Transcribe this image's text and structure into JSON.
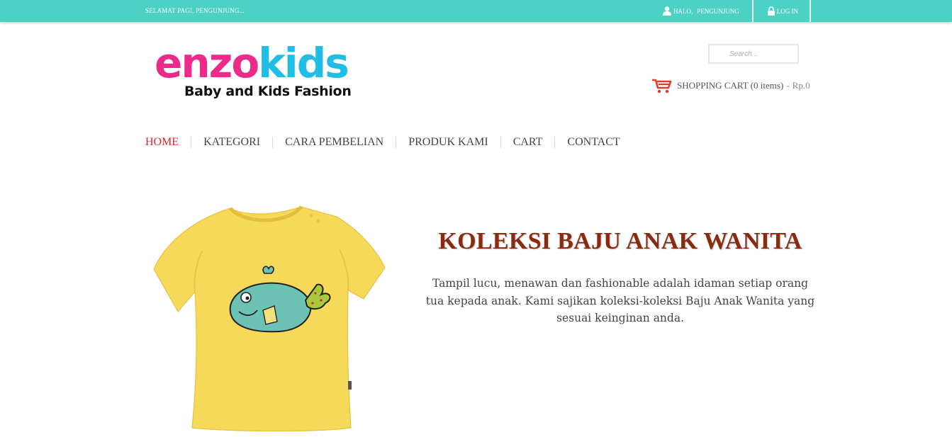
{
  "topbar": {
    "greeting": "SELAMAT PAGI, PENGUNJUNG...",
    "hello_label": "HALO,",
    "hello_user": "PENGUNJUNG",
    "login_label": "LOG IN"
  },
  "logo": {
    "part1": "enzo",
    "part2": "kids",
    "tagline": "Baby and Kids Fashion"
  },
  "search": {
    "placeholder": "Search..."
  },
  "cart": {
    "label": "SHOPPING CART (0 items)",
    "separator": "-",
    "amount": "Rp.0"
  },
  "nav": {
    "items": [
      {
        "label": "HOME",
        "active": true
      },
      {
        "label": "KATEGORI"
      },
      {
        "label": "CARA PEMBELIAN"
      },
      {
        "label": "PRODUK KAMI"
      },
      {
        "label": "CART"
      },
      {
        "label": "CONTACT"
      }
    ]
  },
  "hero": {
    "title": "KOLEKSI BAJU ANAK WANITA",
    "description": "Tampil lucu, menawan dan fashionable adalah idaman setiap orang tua kepada anak. Kami sajikan koleksi-koleksi Baju Anak Wanita yang sesuai keinginan anda."
  },
  "colors": {
    "topbar": "#4dd1c4",
    "logo_pink": "#ec2a8a",
    "logo_blue": "#20bde6",
    "nav_active": "#d6262e",
    "hero_title": "#8a2b0f",
    "cart_icon": "#e03a2f",
    "shirt": "#f7d95a"
  },
  "icons": {
    "user": "user-icon",
    "lock": "lock-icon",
    "cart": "shopping-cart-icon"
  }
}
